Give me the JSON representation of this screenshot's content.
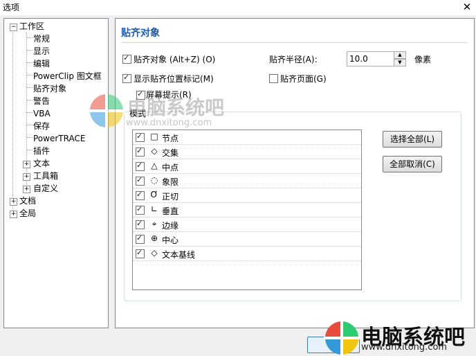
{
  "window": {
    "title": "选项",
    "close_glyph": "✕"
  },
  "tree": {
    "root": "工作区",
    "children": [
      "常规",
      "显示",
      "编辑",
      "PowerClip 图文框",
      "贴齐对象",
      "警告",
      "VBA",
      "保存",
      "PowerTRACE",
      "插件"
    ],
    "expandable_children": [
      "文本",
      "工具箱",
      "自定义"
    ],
    "top_levels": [
      "文档",
      "全局"
    ],
    "expander_plus": "+",
    "expander_minus": "−"
  },
  "panel": {
    "heading": "贴齐对象",
    "snap_to_objects": {
      "label": "贴齐对象 (Alt+Z) (O)",
      "checked": true
    },
    "show_snap_marker": {
      "label": "显示贴齐位置标记(M)",
      "checked": true
    },
    "screen_tips": {
      "label": "屏幕提示(R)",
      "checked": true
    },
    "snap_radius": {
      "label": "贴齐半径(A):",
      "value": "10.0",
      "unit": "像素"
    },
    "snap_page": {
      "label": "贴齐页面(G)",
      "checked": false
    },
    "modes_label": "模式",
    "modes": [
      {
        "icon": "□",
        "label": "节点",
        "checked": true
      },
      {
        "icon": "◇",
        "label": "交集",
        "checked": true
      },
      {
        "icon": "△",
        "label": "中点",
        "checked": true
      },
      {
        "icon": "◌",
        "label": "象限",
        "checked": true
      },
      {
        "icon": "Ơ",
        "label": "正切",
        "checked": true
      },
      {
        "icon": "∟",
        "label": "垂直",
        "checked": true
      },
      {
        "icon": "⌖",
        "label": "边缘",
        "checked": true
      },
      {
        "icon": "⊕",
        "label": "中心",
        "checked": true
      },
      {
        "icon": "◇",
        "label": "文本基线",
        "checked": true
      }
    ],
    "select_all": "选择全部(L)",
    "deselect_all": "全部取消(C)"
  },
  "watermark": {
    "text": "电脑系统吧",
    "url": "www.dnxitong.com",
    "colors": [
      "#e74c3c",
      "#2ecc71",
      "#3498db",
      "#f1c40f"
    ]
  }
}
